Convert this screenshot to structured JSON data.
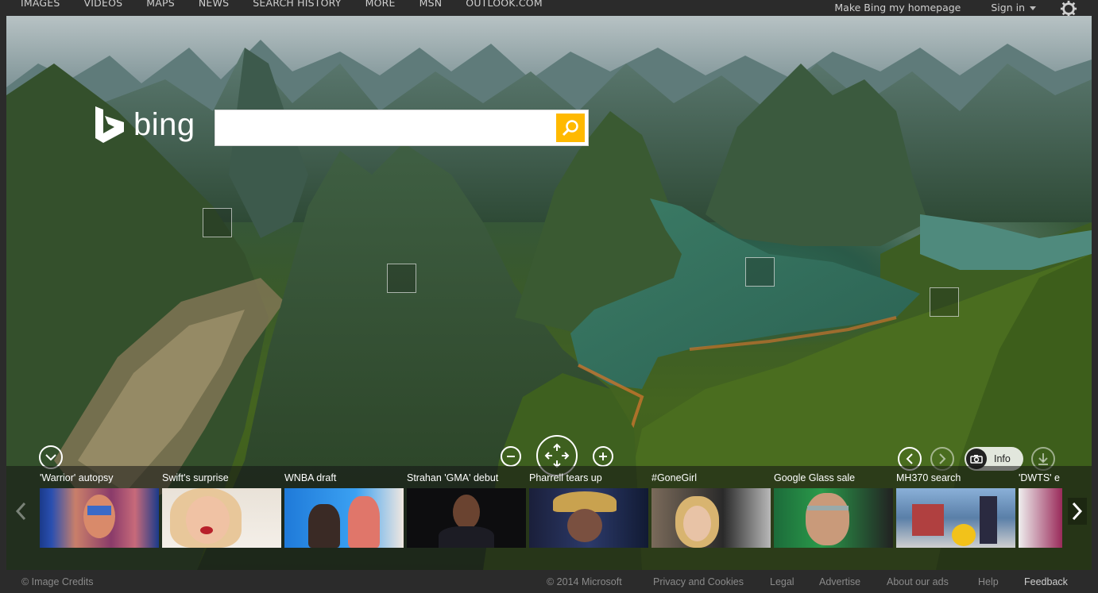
{
  "topnav": {
    "items": [
      "IMAGES",
      "VIDEOS",
      "MAPS",
      "NEWS",
      "SEARCH HISTORY",
      "MORE",
      "MSN",
      "OUTLOOK.COM"
    ],
    "homepage_link": "Make Bing my homepage",
    "sign_in": "Sign in"
  },
  "logo": {
    "word": "bing"
  },
  "search": {
    "value": "",
    "placeholder": ""
  },
  "controls": {
    "info_label": "Info"
  },
  "news": [
    {
      "title": "'Warrior' autopsy",
      "thumb": "warrior-photo"
    },
    {
      "title": "Swift's surprise",
      "thumb": "swift-photo"
    },
    {
      "title": "WNBA draft",
      "thumb": "wnba-photo"
    },
    {
      "title": "Strahan 'GMA' debut",
      "thumb": "strahan-photo"
    },
    {
      "title": "Pharrell tears up",
      "thumb": "pharrell-photo"
    },
    {
      "title": "#GoneGirl",
      "thumb": "gonegirl-photo"
    },
    {
      "title": "Google Glass sale",
      "thumb": "glass-photo"
    },
    {
      "title": "MH370 search",
      "thumb": "mh370-photo"
    },
    {
      "title": "'DWTS' e",
      "thumb": "dwts-photo"
    }
  ],
  "footer": {
    "image_credits": "© Image Credits",
    "copyright": "© 2014 Microsoft",
    "privacy": "Privacy and Cookies",
    "legal": "Legal",
    "advertise": "Advertise",
    "about_ads": "About our ads",
    "help": "Help",
    "feedback": "Feedback"
  },
  "colors": {
    "search_button": "#ffb900",
    "top_bar": "#2b2b2b"
  }
}
